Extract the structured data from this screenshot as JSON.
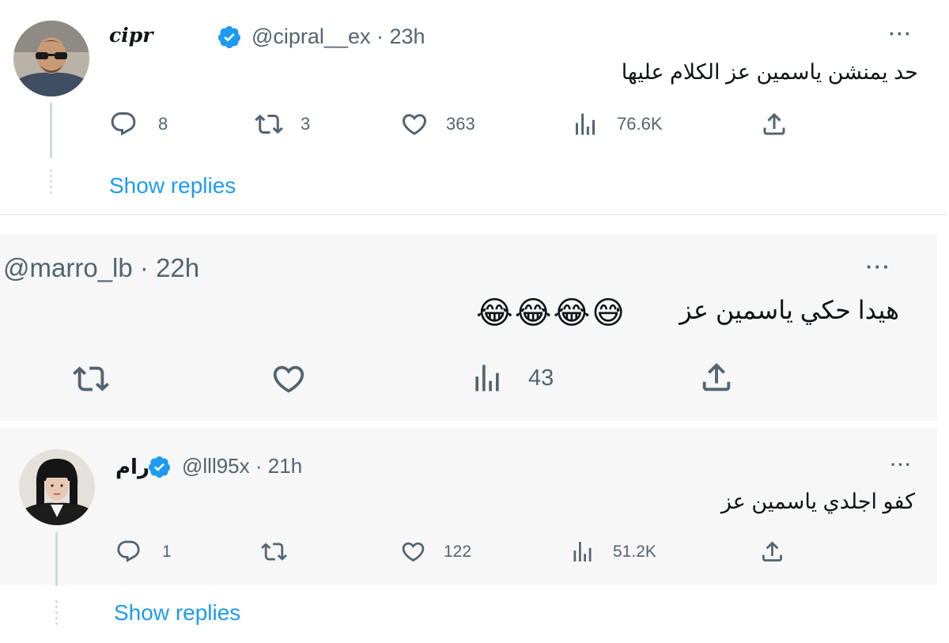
{
  "tweets": [
    {
      "name": "cipr",
      "handle": "@cipral__ex",
      "time": "23h",
      "text": "حد يمنشن ياسمين عز الكلام عليها",
      "replies": "8",
      "retweets": "3",
      "likes": "363",
      "views": "76.6K",
      "show_replies": "Show replies"
    },
    {
      "handle": "@marro_lb",
      "time": "22h",
      "text": "هيدا حكي ياسمين عز",
      "emojis": [
        "😅",
        "😂",
        "😂",
        "😂"
      ],
      "views": "43"
    },
    {
      "name": "رام",
      "handle": "@lll95x",
      "time": "21h",
      "text": "كفو اجلدي ياسمين عز",
      "replies": "1",
      "likes": "122",
      "views": "51.2K",
      "show_replies": "Show replies"
    }
  ],
  "separator": "·",
  "more_icon": "···",
  "icons": [
    "reply-icon",
    "retweet-icon",
    "like-icon",
    "views-icon",
    "share-icon",
    "more-icon",
    "verified-badge-icon"
  ],
  "colors": {
    "link": "#1d9bf0",
    "verified": "#1d9bf0",
    "muted": "#536471"
  }
}
